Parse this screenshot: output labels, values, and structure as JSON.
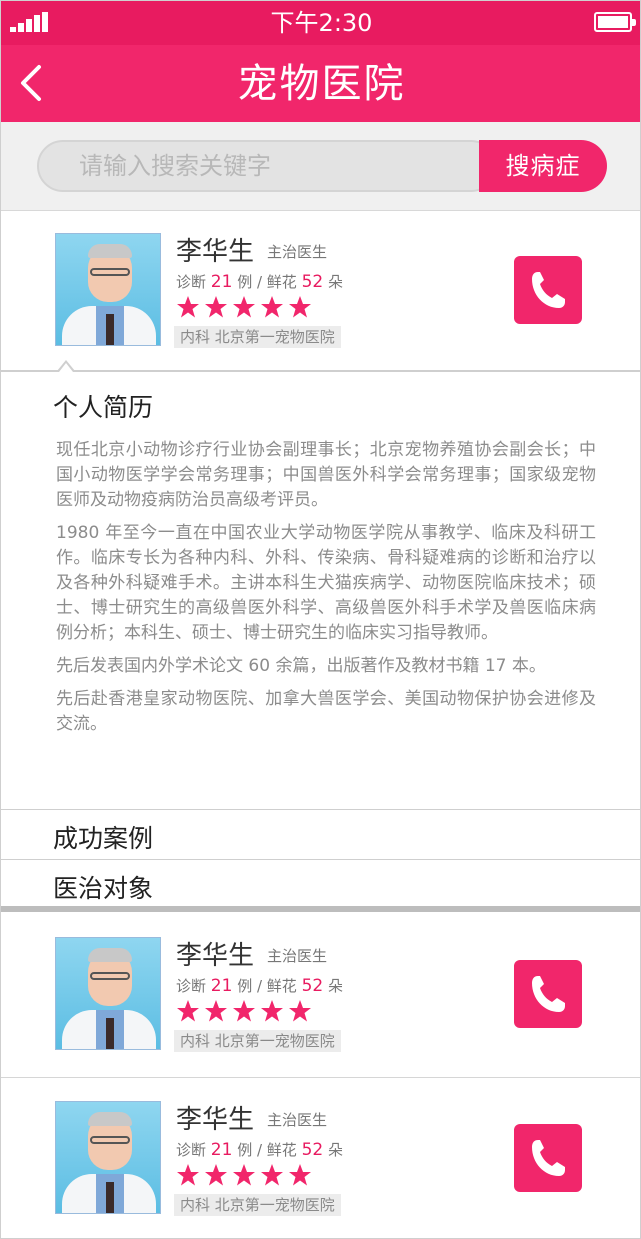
{
  "status_bar": {
    "time": "下午2:30"
  },
  "nav": {
    "title": "宠物医院"
  },
  "search": {
    "placeholder": "请输入搜索关键字",
    "button_label": "搜病症"
  },
  "doctors": [
    {
      "name": "李华生",
      "title": "主治医生",
      "stats_prefix": "诊断",
      "diagnoses": "21",
      "stats_mid": "例 / 鲜花",
      "flowers": "52",
      "stats_suffix": "朵",
      "rating": 5,
      "department": "内科 北京第一宠物医院"
    },
    {
      "name": "李华生",
      "title": "主治医生",
      "stats_prefix": "诊断",
      "diagnoses": "21",
      "stats_mid": "例 / 鲜花",
      "flowers": "52",
      "stats_suffix": "朵",
      "rating": 5,
      "department": "内科 北京第一宠物医院"
    },
    {
      "name": "李华生",
      "title": "主治医生",
      "stats_prefix": "诊断",
      "diagnoses": "21",
      "stats_mid": "例 / 鲜花",
      "flowers": "52",
      "stats_suffix": "朵",
      "rating": 5,
      "department": "内科 北京第一宠物医院"
    }
  ],
  "bio": {
    "heading": "个人简历",
    "paragraphs": [
      "现任北京小动物诊疗行业协会副理事长；北京宠物养殖协会副会长；中国小动物医学学会常务理事；中国兽医外科学会常务理事；国家级宠物医师及动物疫病防治员高级考评员。",
      "1980 年至今一直在中国农业大学动物医学院从事教学、临床及科研工作。临床专长为各种内科、外科、传染病、骨科疑难病的诊断和治疗以及各种外科疑难手术。主讲本科生犬猫疾病学、动物医院临床技术；硕士、博士研究生的高级兽医外科学、高级兽医外科手术学及兽医临床病例分析；本科生、硕士、博士研究生的临床实习指导教师。",
      "先后发表国内外学术论文 60 余篇，出版著作及教材书籍 17 本。",
      "先后赴香港皇家动物医院、加拿大兽医学会、美国动物保护协会进修及交流。"
    ]
  },
  "sections": {
    "cases": "成功案例",
    "targets": "医治对象"
  },
  "colors": {
    "accent": "#f1266b",
    "status_bar": "#e81b60"
  },
  "icons": {
    "back": "chevron-left-icon",
    "call": "phone-icon",
    "star": "star-icon"
  }
}
